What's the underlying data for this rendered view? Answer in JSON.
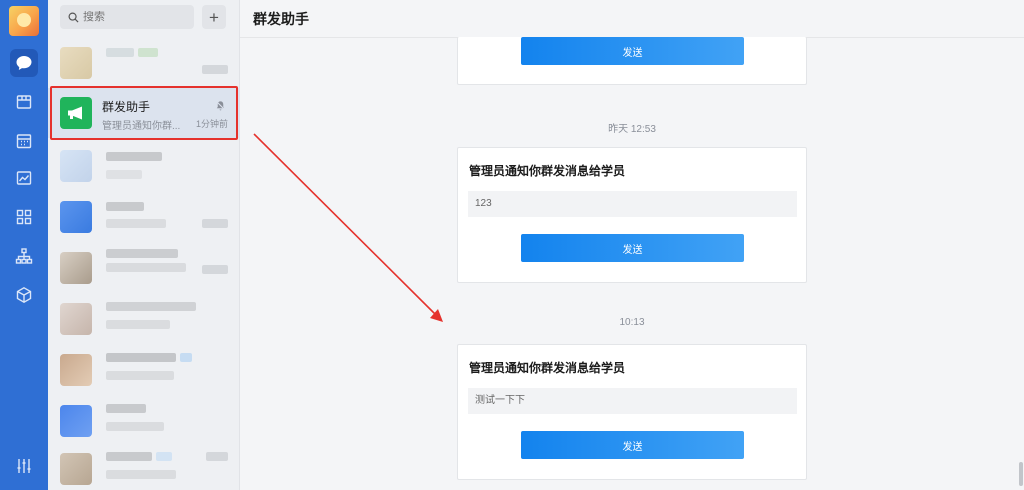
{
  "search": {
    "placeholder": "搜索"
  },
  "header": {
    "title": "群发助手"
  },
  "selected_conversation": {
    "name": "群发助手",
    "preview": "管理员通知你群...",
    "time": "1分钟前"
  },
  "messages": [
    {
      "send_label": "发送"
    },
    {
      "timestamp": "昨天 12:53",
      "title": "管理员通知你群发消息给学员",
      "content": "123",
      "send_label": "发送"
    },
    {
      "timestamp": "10:13",
      "title": "管理员通知你群发消息给学员",
      "content": "测试一下下",
      "send_label": "发送"
    }
  ],
  "colors": {
    "rail": "#2f6fd4",
    "accent": "#1383ee",
    "highlight": "#e5322d",
    "assistant_icon": "#20b45b"
  }
}
